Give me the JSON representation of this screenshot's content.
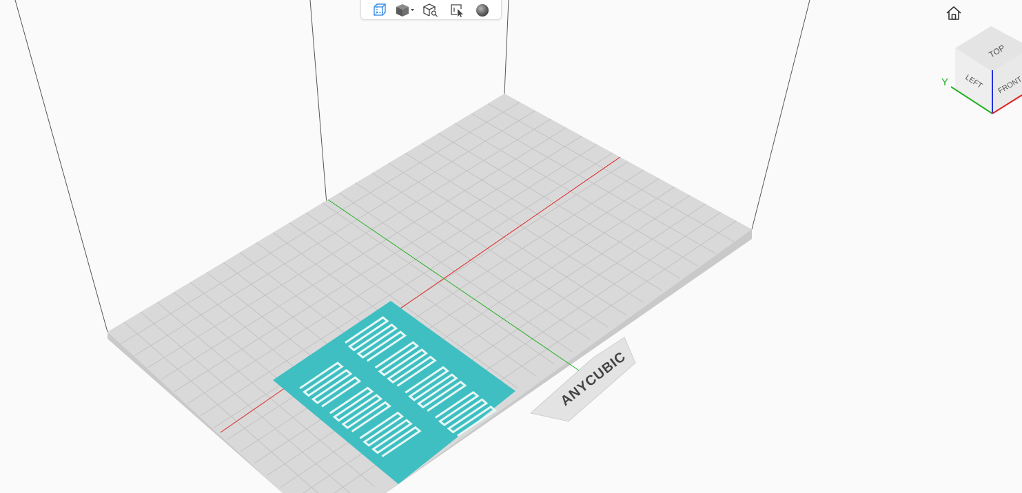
{
  "toolbar": {
    "buttons": [
      {
        "id": "perspective-view-button",
        "icon": "wireframe-cube-icon",
        "active": true
      },
      {
        "id": "shading-mode-button",
        "icon": "solid-cube-dropdown-icon"
      },
      {
        "id": "zoom-to-fit-button",
        "icon": "cube-magnifier-icon"
      },
      {
        "id": "select-tool-button",
        "icon": "frame-cursor-icon"
      },
      {
        "id": "render-sphere-button",
        "icon": "sphere-icon"
      }
    ]
  },
  "view_cube": {
    "faces": {
      "top": "TOP",
      "left": "LEFT",
      "front": "FRONT"
    },
    "axis_label_y": "Y"
  },
  "build_plate": {
    "brand": "ANYCUBIC"
  },
  "colors": {
    "accent": "#3a8ee6",
    "plate": "#d9d9d9",
    "grid": "#c4c4c4",
    "model": "#3fbfc1",
    "x_axis": "#e02020",
    "y_axis": "#20b020",
    "z_axis": "#2030e0"
  },
  "layout_note": ""
}
